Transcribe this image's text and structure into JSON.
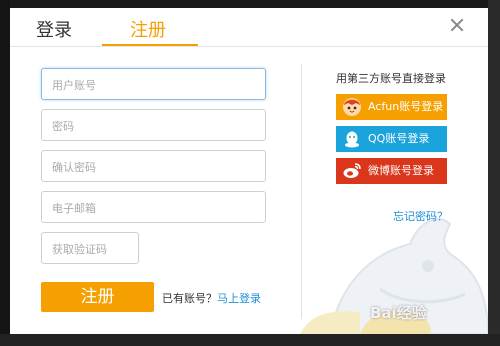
{
  "tabs": {
    "login": "登录",
    "register": "注册"
  },
  "form": {
    "username_placeholder": "用户账号",
    "password_placeholder": "密码",
    "confirm_placeholder": "确认密码",
    "email_placeholder": "电子邮箱",
    "code_placeholder": "获取验证码",
    "submit_label": "注册",
    "have_account_text": "已有账号？",
    "login_link": "马上登录"
  },
  "third_party": {
    "title": "用第三方账号直接登录",
    "buttons": [
      {
        "label": "Acfun账号登录",
        "icon": "acfun-icon",
        "color": "#f5a000"
      },
      {
        "label": "QQ账号登录",
        "icon": "qq-penguin-icon",
        "color": "#1ba3dc"
      },
      {
        "label": "微博账号登录",
        "icon": "weibo-icon",
        "color": "#d9361b"
      }
    ],
    "forgot_password": "忘记密码？"
  },
  "watermark": "Bai经验",
  "colors": {
    "accent": "#f5a000",
    "link": "#1e8fd6"
  }
}
